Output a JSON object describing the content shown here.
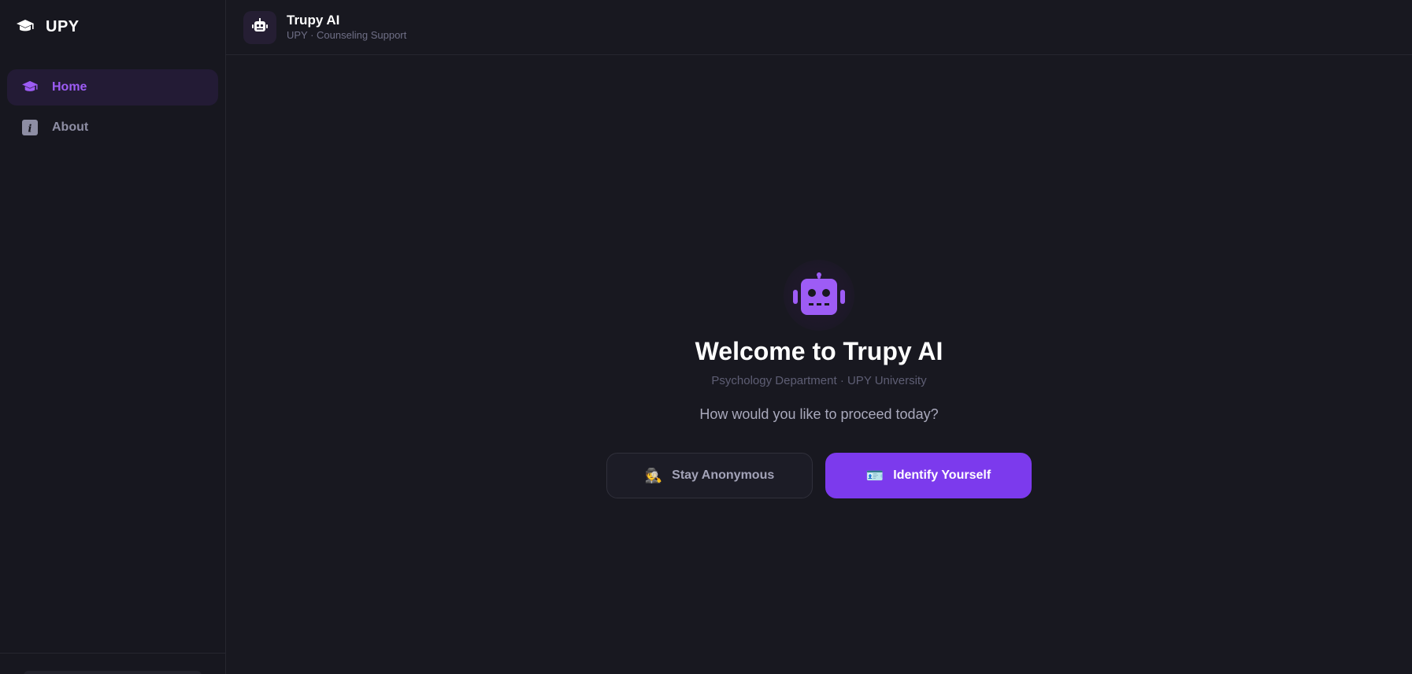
{
  "brand": {
    "name": "UPY",
    "icon": "graduation-cap-icon"
  },
  "sidebar": {
    "items": [
      {
        "label": "Home",
        "icon": "graduation-cap-icon",
        "active": true
      },
      {
        "label": "About",
        "icon": "info-icon",
        "active": false
      }
    ]
  },
  "header": {
    "icon": "robot-icon",
    "title": "Trupy AI",
    "subtitle": "UPY · Counseling Support"
  },
  "welcome": {
    "icon": "robot-icon",
    "title": "Welcome to Trupy AI",
    "subtitle": "Psychology Department · UPY University",
    "prompt": "How would you like to proceed today?",
    "buttons": {
      "anonymous": {
        "emoji": "🕵️",
        "label": "Stay Anonymous"
      },
      "identify": {
        "emoji": "🪪",
        "label": "Identify Yourself"
      }
    }
  },
  "colors": {
    "accent": "#7c3aed",
    "accent_text": "#9d5cf5",
    "background": "#181820",
    "sidebar": "#17171f"
  }
}
